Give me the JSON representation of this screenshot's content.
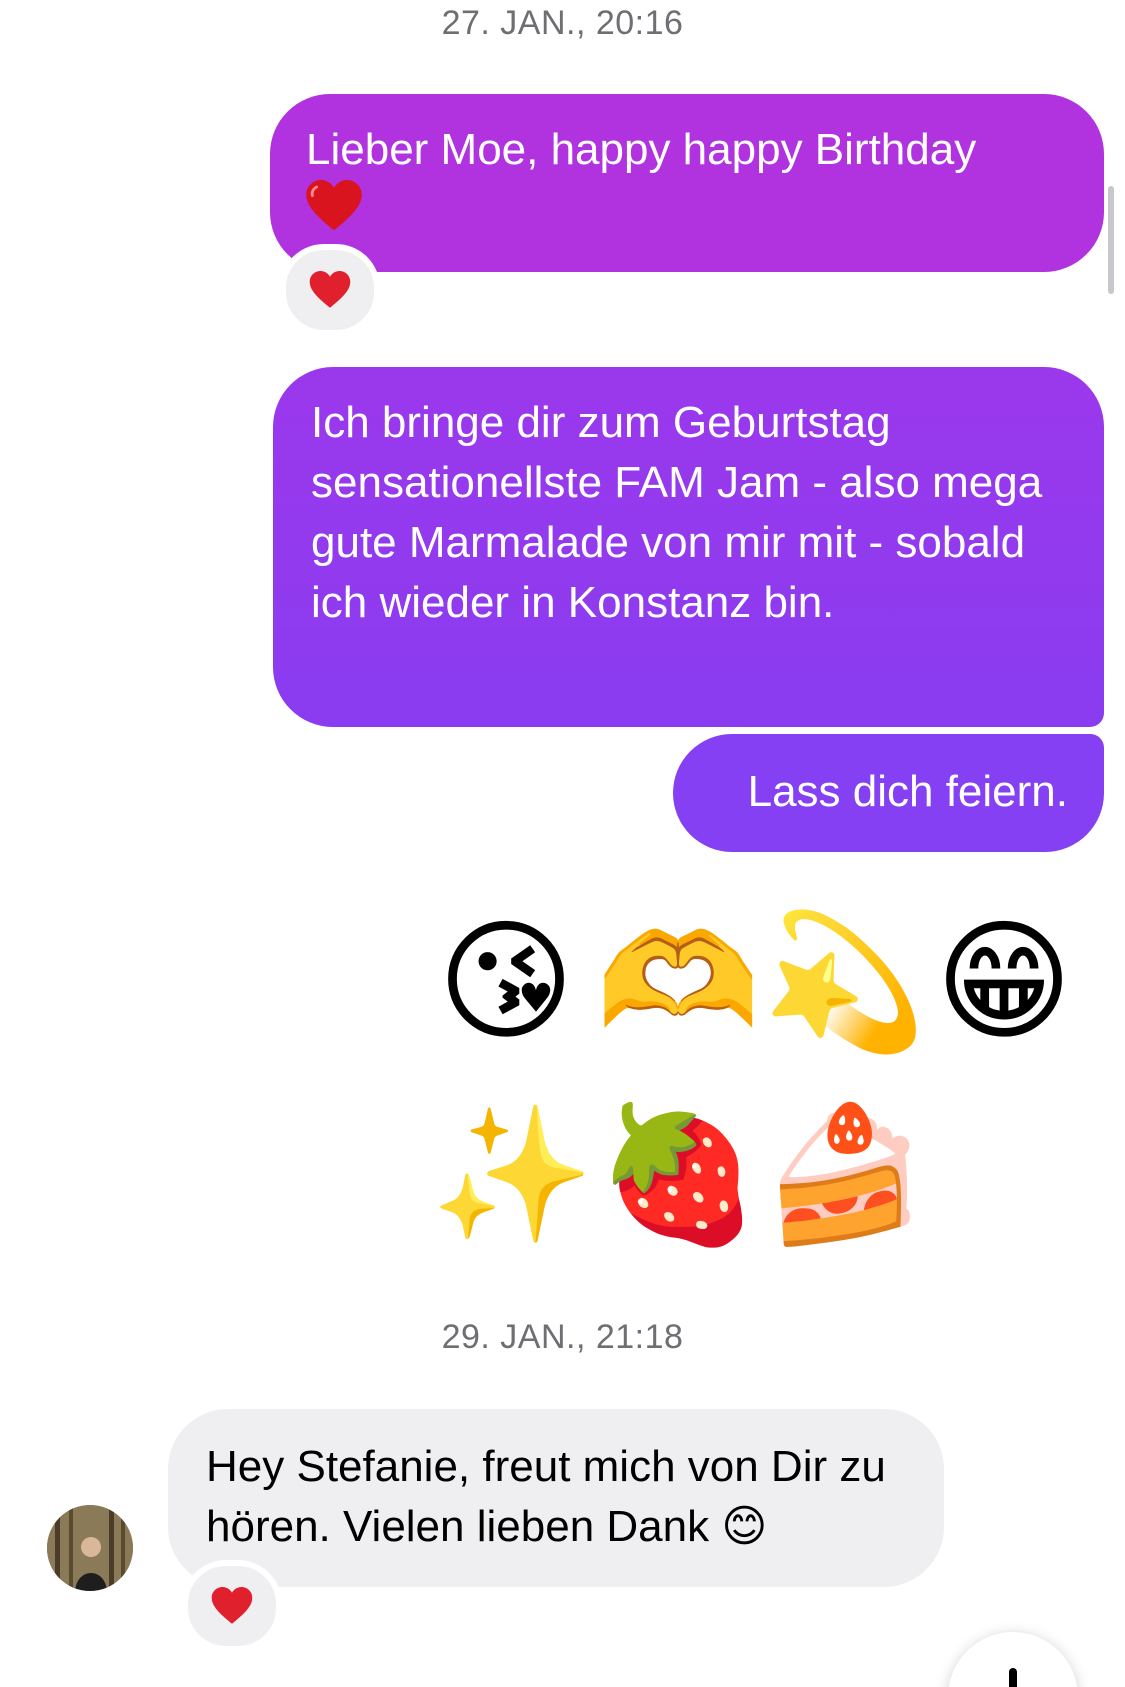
{
  "conversation": {
    "timestamps": [
      "27. JAN., 20:16",
      "29. JAN., 21:18"
    ],
    "messages": {
      "m1": {
        "text": "Lieber Moe, happy happy Birthday",
        "emoji": "❤️",
        "reaction": "heart"
      },
      "m2": {
        "text": "Ich bringe dir zum Geburtstag sensationellste FAM Jam - also mega gute Marmalade von mir mit - sobald ich wieder in Konstanz bin."
      },
      "m3": {
        "text": "Lass dich feiern."
      },
      "emoji_row_1": [
        "😘",
        "🫶",
        "💫",
        "😁"
      ],
      "emoji_row_2": [
        "✨",
        "🍓",
        "🍰"
      ],
      "m4": {
        "text": "Hey Stefanie, freut mich von Dir zu hören. Vielen lieben Dank",
        "emoji": "😊",
        "reaction": "heart"
      }
    }
  },
  "colors": {
    "outgoing_top": "#b133e0",
    "outgoing_bottom": "#8440f2",
    "incoming": "#efeff1",
    "reaction_heart": "#e0202c"
  },
  "icons": {
    "reaction": "heart-icon",
    "scroll_down": "arrow-down-icon"
  }
}
